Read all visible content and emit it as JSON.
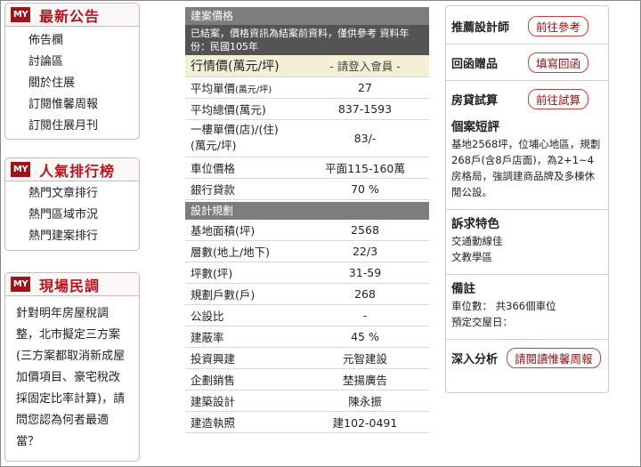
{
  "announce": {
    "title": "最新公告",
    "logo": "MY",
    "items": [
      "佈告欄",
      "討論區",
      "關於住展",
      "訂閱惟馨周報",
      "訂閱住展月刊"
    ]
  },
  "ranking": {
    "title": "人氣排行榜",
    "logo": "MY",
    "items": [
      "熱門文章排行",
      "熱門區域市況",
      "熱門建案排行"
    ]
  },
  "poll": {
    "title": "現場民調",
    "logo": "MY",
    "question": "針對明年房屋稅調整，北市擬定三方案(三方案都取消新成屋加價項目、豪宅稅改採固定比率計算)，請問您認為何者最適當？"
  },
  "price": {
    "header": "建案價格",
    "note": "已結案，價格資訊為結案前資料，僅供參考 資料年份：民國105年",
    "rows": [
      {
        "k": "行情價(萬元/坪)",
        "v": "- 請登入會員 -"
      },
      {
        "k": "平均單價",
        "k_small": "(萬元/坪)",
        "v": "27"
      },
      {
        "k": "平均總價(萬元)",
        "v": "837-1593"
      },
      {
        "k": "一樓單價(店)/(住)",
        "k2": "(萬元/坪)",
        "v": "83/-"
      },
      {
        "k": "車位價格",
        "v": "平面115-160萬"
      },
      {
        "k": "銀行貸款",
        "v": "70 %"
      }
    ]
  },
  "plan": {
    "header": "設計規劃",
    "rows": [
      {
        "k": "基地面積(坪)",
        "v": "2568"
      },
      {
        "k": "層數(地上/地下)",
        "v": "22/3"
      },
      {
        "k": "坪數(坪)",
        "v": "31-59"
      },
      {
        "k": "規劃戶數(戶)",
        "v": "268"
      },
      {
        "k": "公設比",
        "v": "-"
      },
      {
        "k": "建蔽率",
        "v": "45 %"
      },
      {
        "k": "投資興建",
        "v": "元智建設"
      },
      {
        "k": "企劃銷售",
        "v": "埜揚廣告"
      },
      {
        "k": "建築設計",
        "v": "陳永振"
      },
      {
        "k": "建造執照",
        "v": "建102-0491"
      }
    ]
  },
  "side": {
    "r1_label": "推薦設計師",
    "r1_btn": "前往參考",
    "r2_label": "回函贈品",
    "r2_btn": "填寫回函",
    "r3_label": "房貸試算",
    "r3_btn": "前往試算",
    "review_title": "個案短評",
    "review_text": "基地2568坪，位埔心地區，規劃268戶(含8戶店面)，為2+1~4房格局，強調建商品牌及多棟休閒公設。",
    "feature_title": "訴求特色",
    "features": [
      "交通動線佳",
      "文教學區"
    ],
    "remark_title": "備註",
    "remarks": [
      "車位數： 共366個車位",
      "預定交屋日："
    ],
    "deep_label": "深入分析",
    "deep_btn": "請閱讀惟馨周報"
  }
}
